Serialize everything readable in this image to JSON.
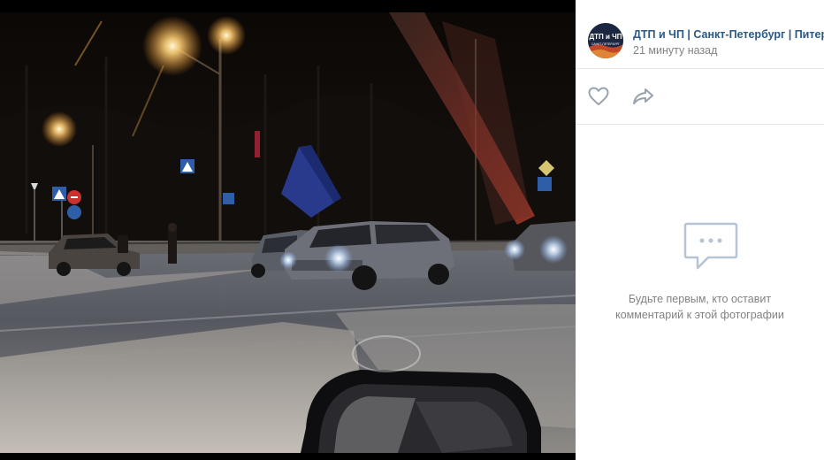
{
  "post": {
    "group_name": "ДТП и ЧП | Санкт-Петербург | Питер Онлайн | СПб",
    "time": "21 минуту назад",
    "avatar_text_top": "ДТП и ЧП",
    "avatar_text_bottom": "САНКТ-ПЕТЕРБУРГ"
  },
  "actions": {
    "like_icon": "heart-icon",
    "share_icon": "share-arrow-icon"
  },
  "comments": {
    "empty_icon": "comment-bubble-icon",
    "empty_text": "Будьте первым, кто оставит комментарий к этой фотографии"
  },
  "colors": {
    "link_blue": "#2a5885",
    "muted_text": "#828282",
    "icon_grey": "#99a2ad",
    "divider": "#e7e8ec"
  }
}
